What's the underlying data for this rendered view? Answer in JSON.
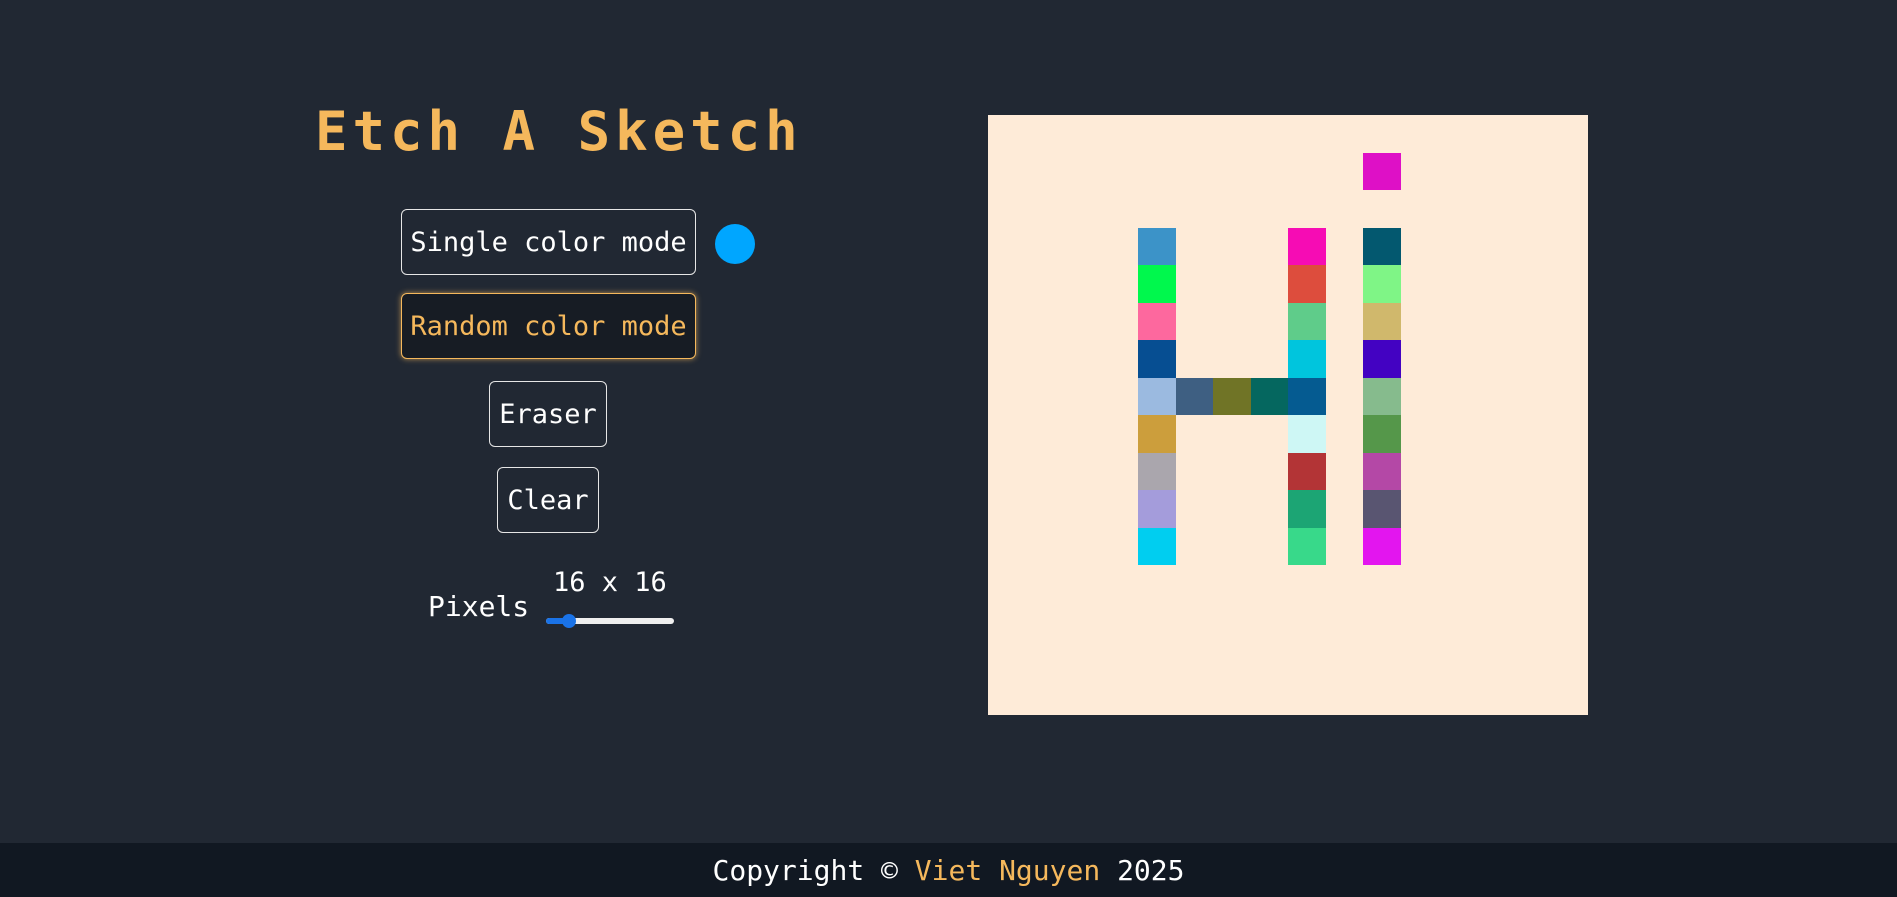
{
  "title": "Etch A Sketch",
  "controls": {
    "single_color_label": "Single color mode",
    "random_color_label": "Random color mode",
    "eraser_label": "Eraser",
    "clear_label": "Clear",
    "selected_color": "#00a6ff",
    "active_mode": "random"
  },
  "pixels": {
    "label": "Pixels",
    "readout": "16 x 16",
    "value": 16,
    "min": 8,
    "max": 64
  },
  "grid": {
    "size": 16,
    "background": "#feebd8",
    "cells": [
      {
        "row": 1,
        "col": 10,
        "color": "#de10c6"
      },
      {
        "row": 3,
        "col": 4,
        "color": "#3c93c8"
      },
      {
        "row": 3,
        "col": 8,
        "color": "#f60cb4"
      },
      {
        "row": 3,
        "col": 10,
        "color": "#03586f"
      },
      {
        "row": 4,
        "col": 4,
        "color": "#00f84d"
      },
      {
        "row": 4,
        "col": 8,
        "color": "#dd4d3d"
      },
      {
        "row": 4,
        "col": 10,
        "color": "#7ff586"
      },
      {
        "row": 5,
        "col": 4,
        "color": "#fd689e"
      },
      {
        "row": 5,
        "col": 8,
        "color": "#5fcc8a"
      },
      {
        "row": 5,
        "col": 10,
        "color": "#d0b86c"
      },
      {
        "row": 6,
        "col": 4,
        "color": "#064e92"
      },
      {
        "row": 6,
        "col": 8,
        "color": "#00c5dd"
      },
      {
        "row": 6,
        "col": 10,
        "color": "#4302c2"
      },
      {
        "row": 7,
        "col": 4,
        "color": "#9bbae0"
      },
      {
        "row": 7,
        "col": 5,
        "color": "#3e5f82"
      },
      {
        "row": 7,
        "col": 6,
        "color": "#707426"
      },
      {
        "row": 7,
        "col": 7,
        "color": "#05675f"
      },
      {
        "row": 7,
        "col": 8,
        "color": "#055b91"
      },
      {
        "row": 7,
        "col": 10,
        "color": "#86bb8d"
      },
      {
        "row": 8,
        "col": 4,
        "color": "#cc9e3c"
      },
      {
        "row": 8,
        "col": 8,
        "color": "#cef7f5"
      },
      {
        "row": 8,
        "col": 10,
        "color": "#55974a"
      },
      {
        "row": 9,
        "col": 4,
        "color": "#aaa6ad"
      },
      {
        "row": 9,
        "col": 8,
        "color": "#b33436"
      },
      {
        "row": 9,
        "col": 10,
        "color": "#b448a6"
      },
      {
        "row": 10,
        "col": 4,
        "color": "#a49cdb"
      },
      {
        "row": 10,
        "col": 8,
        "color": "#1ca574"
      },
      {
        "row": 10,
        "col": 10,
        "color": "#595571"
      },
      {
        "row": 11,
        "col": 4,
        "color": "#00cef0"
      },
      {
        "row": 11,
        "col": 8,
        "color": "#38d98a"
      },
      {
        "row": 11,
        "col": 10,
        "color": "#e315ef"
      }
    ]
  },
  "footer": {
    "prefix": "Copyright © ",
    "name": "Viet Nguyen",
    "suffix": " 2025"
  }
}
